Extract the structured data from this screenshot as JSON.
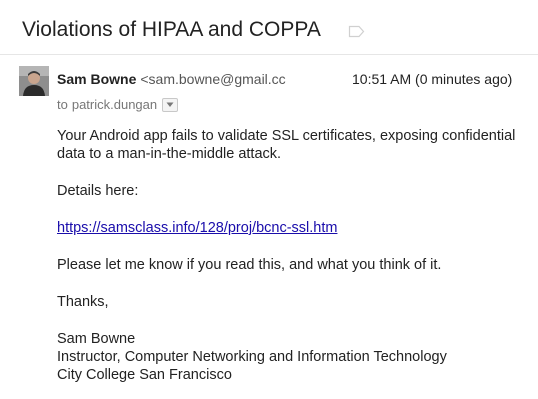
{
  "email": {
    "subject": "Violations of HIPAA and COPPA",
    "sender_name": "Sam Bowne",
    "sender_email": "<sam.bowne@gmail.cc",
    "timestamp": "10:51 AM (0 minutes ago)",
    "to_word": "to",
    "recipient": "patrick.dungan",
    "body": {
      "line1": "Your Android app fails to validate SSL certificates, exposing confidential data to a man-in-the-middle attack.",
      "line2": "Details here:",
      "link": "https://samsclass.info/128/proj/bcnc-ssl.htm",
      "line3": "Please let me know if you read this, and what you think of it.",
      "line4": "Thanks,",
      "signature": {
        "name": "Sam Bowne",
        "title": "Instructor, Computer Networking and Information Technology",
        "org": "City College San Francisco"
      }
    }
  },
  "icons": {
    "label": "label-tag-icon",
    "avatar": "sender-avatar",
    "details": "chevron-down-icon"
  }
}
